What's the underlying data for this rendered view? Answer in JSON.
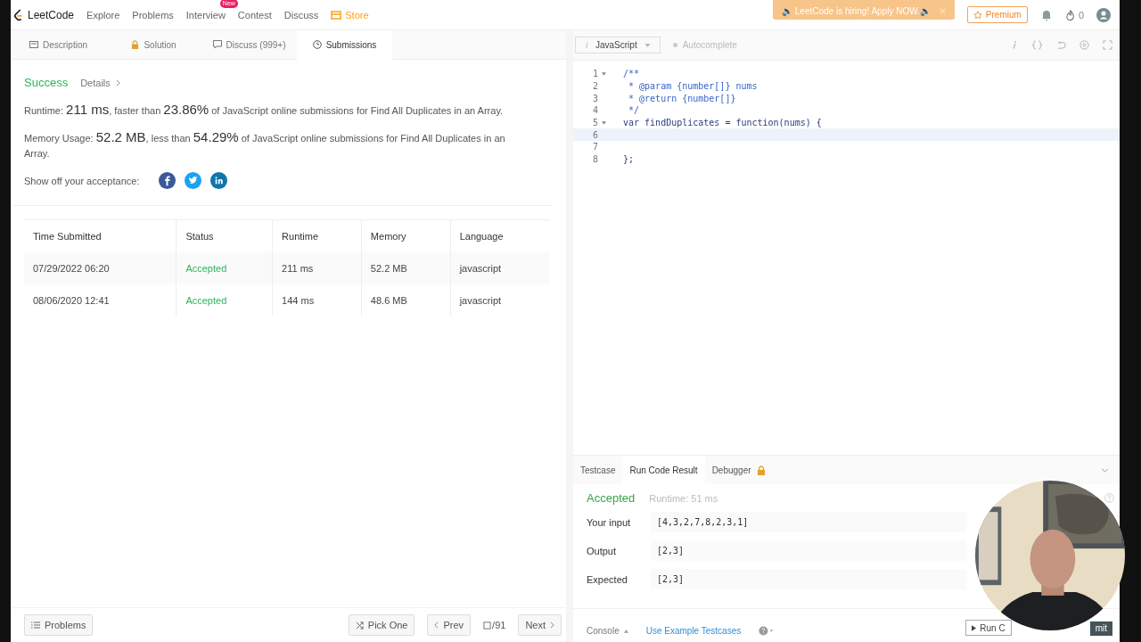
{
  "nav": {
    "logo": "LeetCode",
    "items": [
      {
        "label": "Explore"
      },
      {
        "label": "Problems"
      },
      {
        "label": "Interview",
        "badge": "New"
      },
      {
        "label": "Contest"
      },
      {
        "label": "Discuss"
      }
    ],
    "store": "Store",
    "banner": "🔈 LeetCode is hiring! Apply NOW.🔈",
    "premium": "Premium",
    "streak": "0"
  },
  "tabs": [
    {
      "label": "Description",
      "selected": false
    },
    {
      "label": "Solution",
      "selected": false
    },
    {
      "label": "Discuss (999+)",
      "selected": false
    },
    {
      "label": "Submissions",
      "selected": true
    }
  ],
  "result": {
    "status": "Success",
    "details": "Details",
    "runtime": "Runtime: **211 ms**, faster than **23.86%** of JavaScript online submissions for Find All Duplicates in an Array.",
    "memory": "Memory Usage: **52.2 MB**, less than **54.29%** of JavaScript online submissions for Find All Duplicates in an Array.",
    "share": "Show off your acceptance:",
    "share_icons": [
      {
        "kind": "facebook"
      },
      {
        "kind": "twitter"
      },
      {
        "kind": "linkedin"
      }
    ]
  },
  "table": {
    "columns": [
      "Time Submitted",
      "Status",
      "Runtime",
      "Memory",
      "Language"
    ],
    "rows": [
      [
        "07/29/2022 06:20",
        "Accepted",
        "211 ms",
        "52.2 MB",
        "javascript"
      ],
      [
        "08/06/2020 12:41",
        "Accepted",
        "144 ms",
        "48.6 MB",
        "javascript"
      ]
    ]
  },
  "footer": {
    "problems": "Problems",
    "pick": "Pick One",
    "prev": "Prev",
    "page": "/91",
    "next": "Next"
  },
  "editor": {
    "language": "JavaScript",
    "autocomplete": "Autocomplete",
    "lines": [
      {
        "n": "1",
        "text": "/**",
        "kind": "comment",
        "fold": true,
        "current": false
      },
      {
        "n": "2",
        "text": " * @param {number[]} nums",
        "kind": "comment",
        "fold": false,
        "current": false
      },
      {
        "n": "3",
        "text": " * @return {number[]}",
        "kind": "comment",
        "fold": false,
        "current": false
      },
      {
        "n": "4",
        "text": " */",
        "kind": "comment",
        "fold": false,
        "current": false
      },
      {
        "n": "5",
        "text": "var findDuplicates = function(nums) {",
        "kind": "code",
        "fold": true,
        "current": false
      },
      {
        "n": "6",
        "fold": false,
        "current": true
      },
      {
        "n": "7",
        "fold": false,
        "current": false
      },
      {
        "n": "8",
        "text": "};",
        "kind": "code",
        "fold": false,
        "current": false
      }
    ]
  },
  "console": {
    "tabs": [
      {
        "label": "Testcase",
        "selected": false,
        "locked": false
      },
      {
        "label": "Run Code Result",
        "selected": true,
        "locked": false
      },
      {
        "label": "Debugger",
        "selected": false,
        "locked": true
      }
    ],
    "status": "Accepted",
    "runtime": "Runtime: 51 ms",
    "fields": [
      {
        "label": "Your input",
        "value": "[4,3,2,7,8,2,3,1]"
      },
      {
        "label": "Output",
        "value": "[2,3]"
      },
      {
        "label": "Expected",
        "value": "[2,3]"
      }
    ],
    "console": "Console",
    "example": "Use Example Testcases",
    "run": "Run C",
    "submit": "mit"
  }
}
